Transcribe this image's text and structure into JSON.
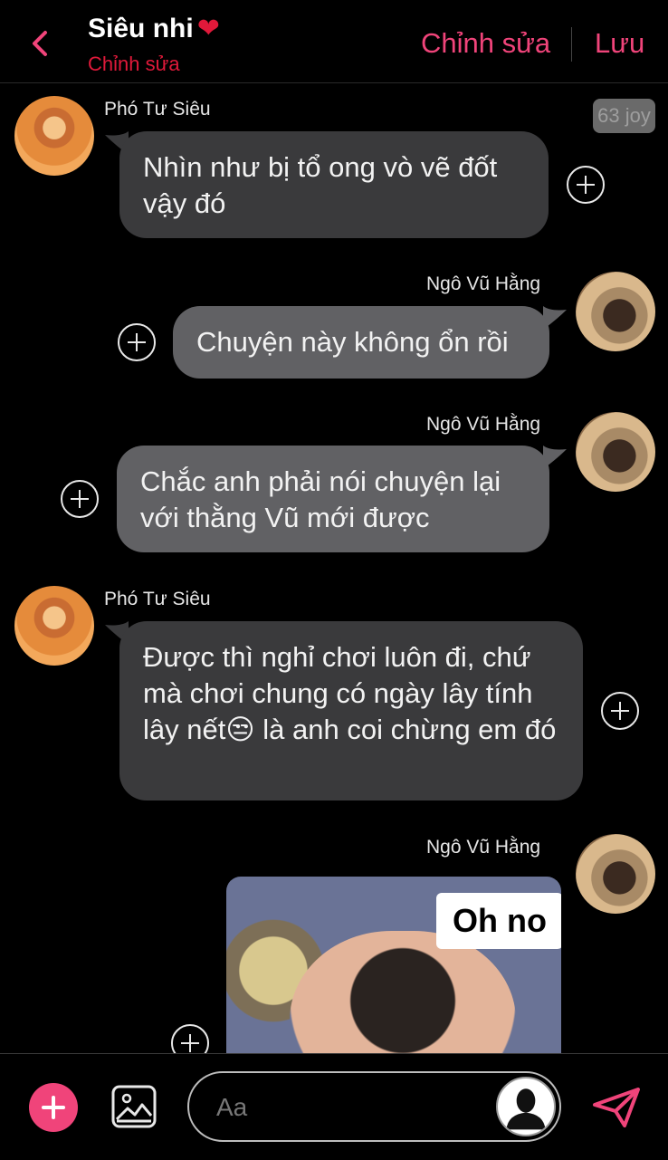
{
  "header": {
    "title": "Siêu nhi",
    "title_heart": "❤",
    "subtitle": "Chỉnh sửa",
    "edit_label": "Chỉnh sửa",
    "save_label": "Lưu"
  },
  "chat": {
    "badge": "63 joy",
    "messages": [
      {
        "sender": "Phó Tư Siêu",
        "text": "Nhìn như bị tổ ong vò vẽ đốt vậy đó"
      },
      {
        "sender": "Ngô Vũ Hằng",
        "text": "Chuyện này không ổn rồi"
      },
      {
        "sender": "Ngô Vũ Hằng",
        "text": "Chắc anh phải nói chuyện lại với thằng Vũ mới được"
      },
      {
        "sender": "Phó Tư Siêu",
        "text": "Được thì nghỉ chơi luôn đi, chứ mà chơi chung có ngày lây tính lây nết😒 là anh coi chừng em đó"
      },
      {
        "sender": "Ngô Vũ Hằng",
        "image_caption": "Oh no"
      }
    ]
  },
  "footer": {
    "placeholder": "Aa"
  },
  "colors": {
    "accent": "#f0447a",
    "header_red": "#e0193a",
    "left_bubble": "#3a3a3c",
    "right_bubble": "#616164",
    "background": "#000000"
  }
}
